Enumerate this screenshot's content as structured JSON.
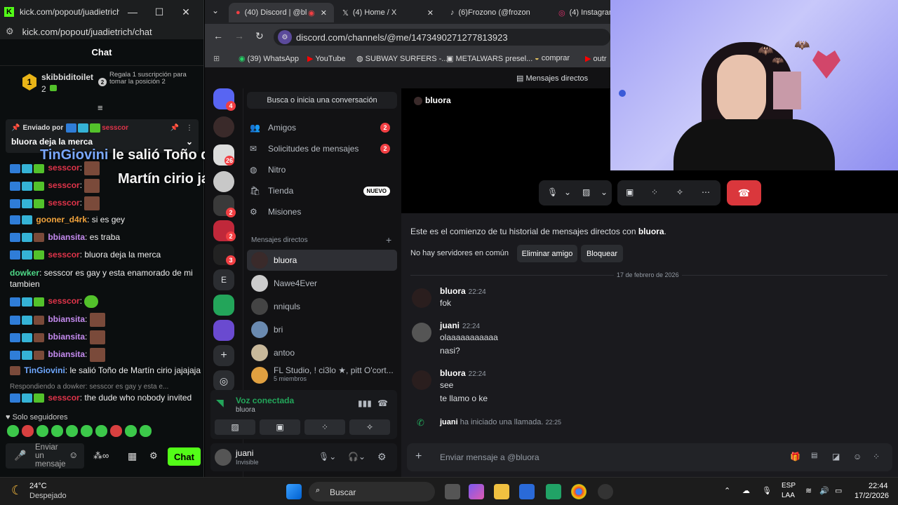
{
  "kick": {
    "window_title": "kick.com/popout/juadietrich/chat...",
    "url": "kick.com/popout/juadietrich/chat",
    "chat_title": "Chat",
    "leader_rank": "1",
    "leader_name": "skibbiditoilet",
    "leader_count": "2",
    "gift_rank": "2",
    "gift_text": "Regala 1 suscripción para tomar la posición 2",
    "pinned_by_label": "Enviado por",
    "pinned_user": "sesscor",
    "pinned_message": "bluora deja la merca",
    "overlay_user": "TinGiovini",
    "overlay_line1": "le salió Toño de",
    "overlay_line2": "Martín cirio jajajaja",
    "messages": [
      {
        "user": "sesscor",
        "text": ":"
      },
      {
        "user": "sesscor",
        "text": ":"
      },
      {
        "user": "sesscor",
        "text": ":"
      },
      {
        "user": "gooner_d4rk",
        "text": ": si es gey"
      },
      {
        "user": "bbiansita",
        "text": ": es traba"
      },
      {
        "user": "sesscor",
        "text": ": bluora deja la merca"
      },
      {
        "user": "dowker",
        "text": ": sesscor es gay y esta enamorado de mi tambien"
      },
      {
        "user": "sesscor",
        "text": ":"
      },
      {
        "user": "bbiansita",
        "text": ":"
      },
      {
        "user": "bbiansita",
        "text": ":"
      },
      {
        "user": "bbiansita",
        "text": ":"
      },
      {
        "user": "TinGiovini",
        "text": ": le salió Toño de Martín cirio jajajaja"
      },
      {
        "user": "sesscor",
        "text": ": the dude who nobody invited"
      }
    ],
    "reply_to": "Respondiendo a dowker: sesscor es gay y esta e...",
    "followers_only": "Solo seguidores",
    "input_placeholder": "Enviar un mensaje",
    "chat_button": "Chat"
  },
  "browser": {
    "tabs": [
      {
        "label": "(40) Discord | @bl",
        "active": true
      },
      {
        "label": "(4) Home / X",
        "active": false
      },
      {
        "label": "(6)Frozono (@frozon",
        "active": false
      },
      {
        "label": "(4) Instagram",
        "active": false
      }
    ],
    "url": "discord.com/channels/@me/1473490271277813923",
    "bookmarks": [
      "(39) WhatsApp",
      "YouTube",
      "SUBWAY SURFERS -...",
      "METALWARS presel...",
      "comprar",
      "outr"
    ]
  },
  "discord": {
    "top_label": "Mensajes directos",
    "search_placeholder": "Busca o inicia una conversación",
    "nav": [
      {
        "label": "Amigos",
        "badge": "2"
      },
      {
        "label": "Solicitudes de mensajes",
        "badge": "2"
      },
      {
        "label": "Nitro",
        "badge": ""
      },
      {
        "label": "Tienda",
        "badge": "NUEVO"
      },
      {
        "label": "Misiones",
        "badge": ""
      }
    ],
    "dm_header": "Mensajes directos",
    "dms": [
      {
        "name": "bluora",
        "sub": ""
      },
      {
        "name": "Nawe4Ever",
        "sub": ""
      },
      {
        "name": "nniquls",
        "sub": ""
      },
      {
        "name": "bri",
        "sub": ""
      },
      {
        "name": "antoo",
        "sub": ""
      },
      {
        "name": "FL Studio, ! ci3lo ★, pitt O'cort...",
        "sub": "5 miembros"
      }
    ],
    "server_badges": [
      "4",
      "26",
      "2",
      "2",
      "3"
    ],
    "server_letter": "E",
    "voice_status": "Voz conectada",
    "voice_channel": "bluora",
    "user_name": "juani",
    "user_status": "Invisible",
    "channel_name": "bluora",
    "history_intro": "Este es el comienzo de tu historial de mensajes directos con",
    "history_user": "bluora",
    "no_servers": "No hay servidores en común",
    "remove_friend": "Eliminar amigo",
    "block": "Bloquear",
    "date_divider": "17 de febrero de 2026",
    "messages": [
      {
        "author": "bluora",
        "time": "22:24",
        "lines": [
          "fok"
        ]
      },
      {
        "author": "juani",
        "time": "22:24",
        "lines": [
          "olaaaaaaaaaaa",
          "nasi?"
        ]
      },
      {
        "author": "bluora",
        "time": "22:24",
        "lines": [
          "see",
          "te llamo o ke"
        ]
      }
    ],
    "call_author": "juani",
    "call_text": "ha iniciado una llamada.",
    "call_time": "22:25",
    "input_placeholder": "Enviar mensaje a @bluora"
  },
  "taskbar": {
    "temp": "24°C",
    "weather": "Despejado",
    "search": "Buscar",
    "lang1": "ESP",
    "lang2": "LAA",
    "time": "22:44",
    "date": "17/2/2026"
  },
  "colors": {
    "kick_green": "#53fc18",
    "discord_red": "#da373c",
    "discord_bg": "#1a1a1e",
    "voice_green": "#23a55a"
  }
}
